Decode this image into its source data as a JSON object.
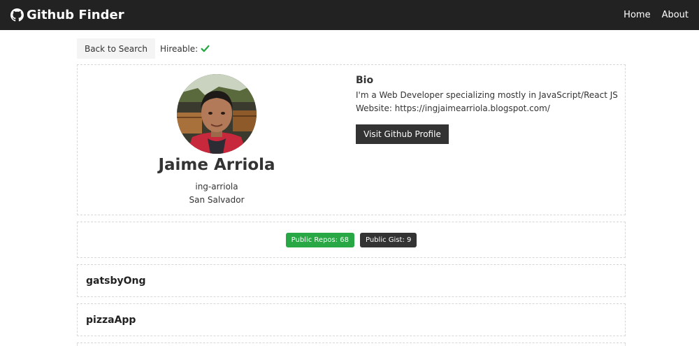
{
  "nav": {
    "brand": "Github Finder",
    "links": [
      "Home",
      "About"
    ]
  },
  "toolbar": {
    "back_label": "Back to Search",
    "hireable_label": "Hireable:"
  },
  "profile": {
    "name": "Jaime Arriola",
    "login": "ing-arriola",
    "location": "San Salvador",
    "bio_heading": "Bio",
    "bio": "I'm a Web Developer specializing mostly in JavaScript/React JS",
    "website": "Website: https://ingjaimearriola.blogspot.com/",
    "visit_label": "Visit Github Profile"
  },
  "stats": {
    "repos": "Public Repos: 68",
    "gists": "Public Gist: 9"
  },
  "repos": [
    "gatsbyOng",
    "pizzaApp"
  ],
  "colors": {
    "navbar": "#222222",
    "badge_green": "#28a745",
    "badge_dark": "#333333",
    "check": "#28a745"
  }
}
